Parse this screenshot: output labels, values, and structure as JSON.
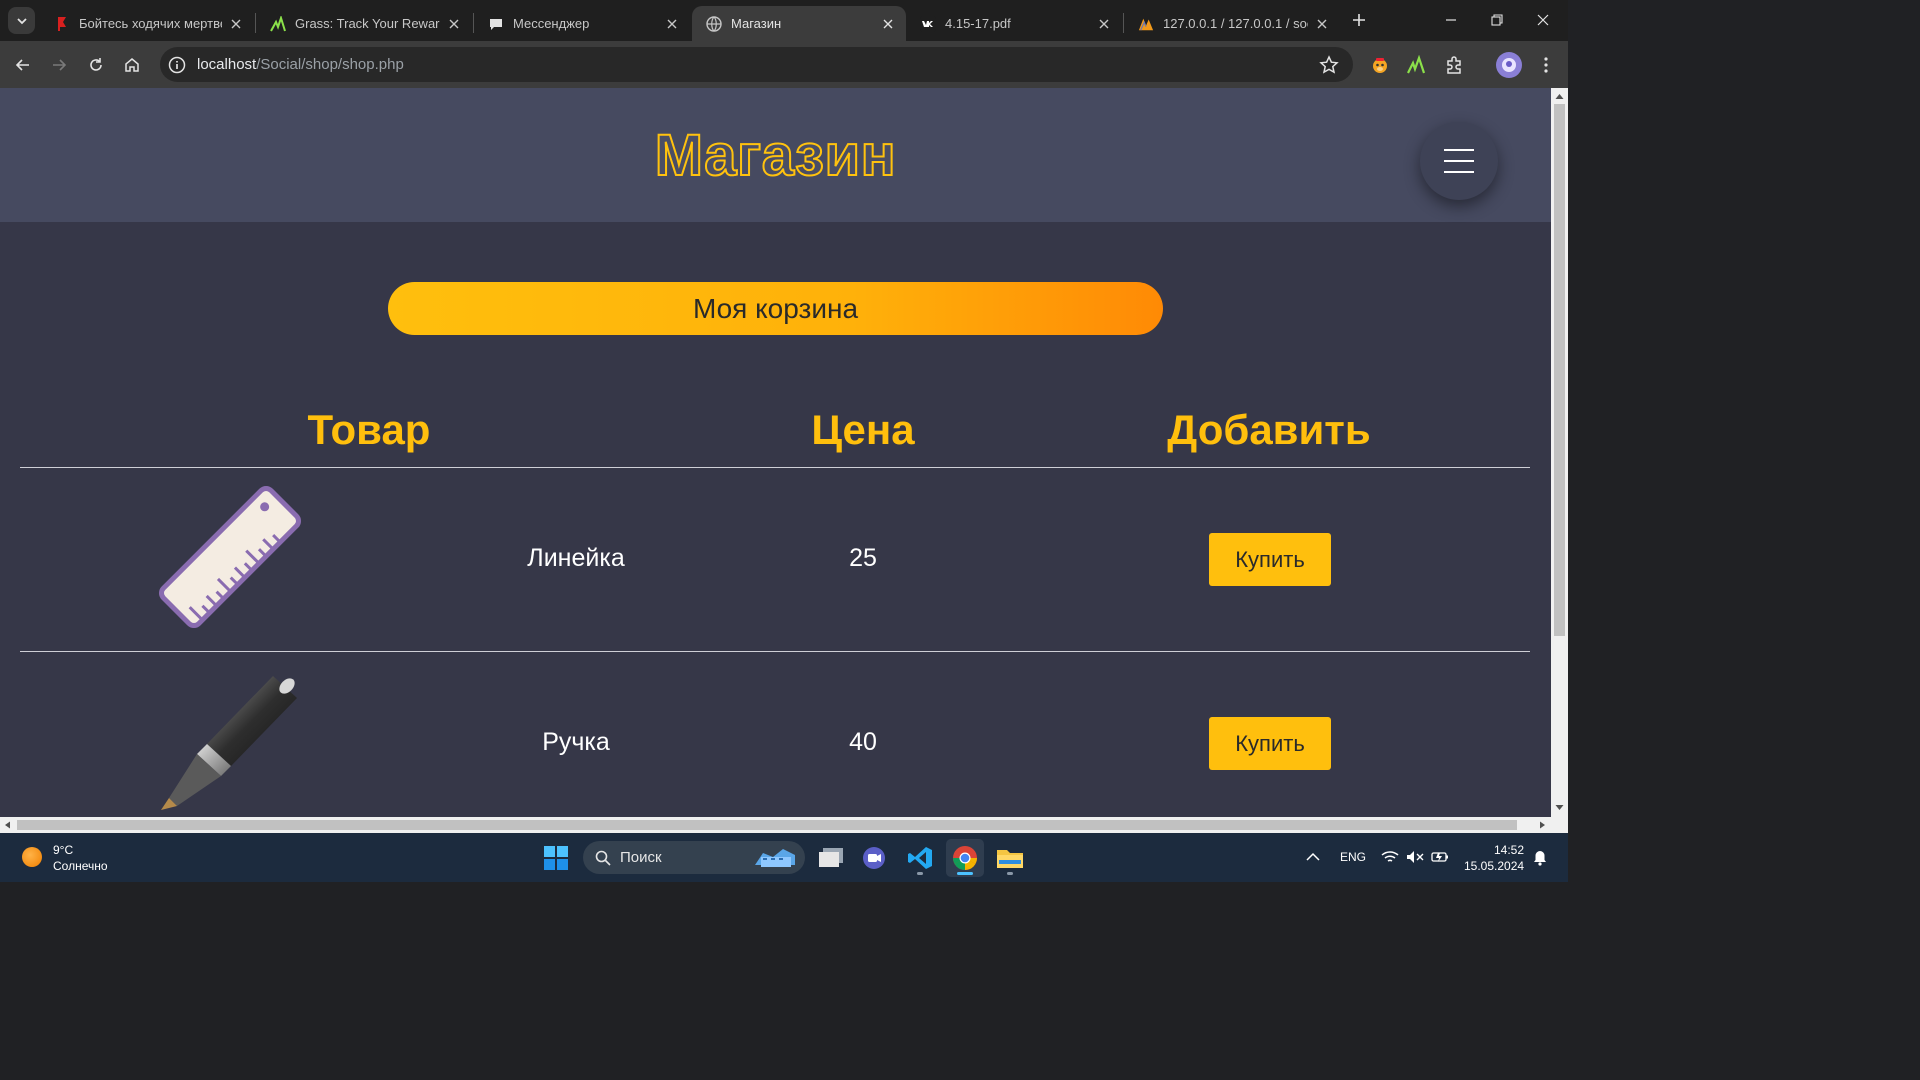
{
  "browser": {
    "tabs": [
      {
        "title": "Бойтесь ходячих мертвец",
        "favicon": "red-flag-icon",
        "active": false
      },
      {
        "title": "Grass: Track Your Rewards",
        "favicon": "grass-icon",
        "active": false
      },
      {
        "title": "Мессенджер",
        "favicon": "chat-bubble-icon",
        "active": false
      },
      {
        "title": "Магазин",
        "favicon": "globe-icon",
        "active": true
      },
      {
        "title": "4.15-17.pdf",
        "favicon": "vk-icon",
        "active": false
      },
      {
        "title": "127.0.0.1 / 127.0.0.1 / socia",
        "favicon": "phpmyadmin-icon",
        "active": false
      }
    ],
    "url_host": "localhost",
    "url_path": "/Social/shop/shop.php"
  },
  "page": {
    "title": "Магазин",
    "cart_button": "Моя корзина",
    "columns": {
      "product": "Товар",
      "price": "Цена",
      "add": "Добавить"
    },
    "products": [
      {
        "name": "Линейка",
        "price": "25",
        "image": "ruler-icon",
        "buy_label": "Купить"
      },
      {
        "name": "Ручка",
        "price": "40",
        "image": "pen-icon",
        "buy_label": "Купить"
      }
    ],
    "colors": {
      "accent": "#ffbf0d",
      "background": "#363748",
      "header": "#464a60"
    }
  },
  "taskbar": {
    "weather_temp": "9°C",
    "weather_desc": "Солнечно",
    "search_label": "Поиск",
    "language": "ENG",
    "time": "14:52",
    "date": "15.05.2024"
  }
}
